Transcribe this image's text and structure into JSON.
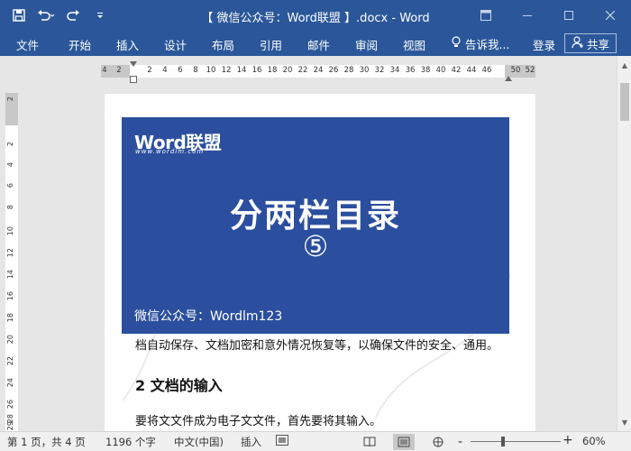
{
  "window": {
    "title": "【 微信公众号：Word联盟 】.docx - Word"
  },
  "ribbon": {
    "tabs": [
      "文件",
      "开始",
      "插入",
      "设计",
      "布局",
      "引用",
      "邮件",
      "审阅",
      "视图"
    ],
    "tell_me": "告诉我...",
    "login": "登录",
    "share": "共享"
  },
  "ruler": {
    "ticks": [
      "4",
      "2",
      "2",
      "4",
      "6",
      "8",
      "10",
      "12",
      "14",
      "16",
      "18",
      "20",
      "22",
      "24",
      "26",
      "28",
      "30",
      "32",
      "34",
      "36",
      "38",
      "40",
      "42",
      "44",
      "46",
      "50",
      "52"
    ],
    "vticks": [
      "2",
      "2",
      "4",
      "6",
      "8",
      "10",
      "12",
      "14",
      "16",
      "18",
      "20",
      "22",
      "24",
      "26",
      "28",
      "29"
    ]
  },
  "banner": {
    "logo": "Word联盟",
    "logo_sub": "www.wordlm.com",
    "title": "分两栏目录",
    "number": "⑤",
    "footer": "微信公众号：Wordlm123"
  },
  "document": {
    "para1": "档自动保存、文档加密和意外情况恢复等，以确保文件的安全、通用。",
    "heading2": "2 文档的输入",
    "para2": "要将文文件成为电子文文件，首先要将其输入。"
  },
  "status": {
    "page": "第 1 页，共 4 页",
    "words": "1196 个字",
    "language": "中文(中国)",
    "mode": "插入",
    "zoom": "60%",
    "zoom_minus": "-",
    "zoom_plus": "+"
  },
  "colors": {
    "brand": "#2b579a",
    "banner": "#2b4f9e"
  }
}
